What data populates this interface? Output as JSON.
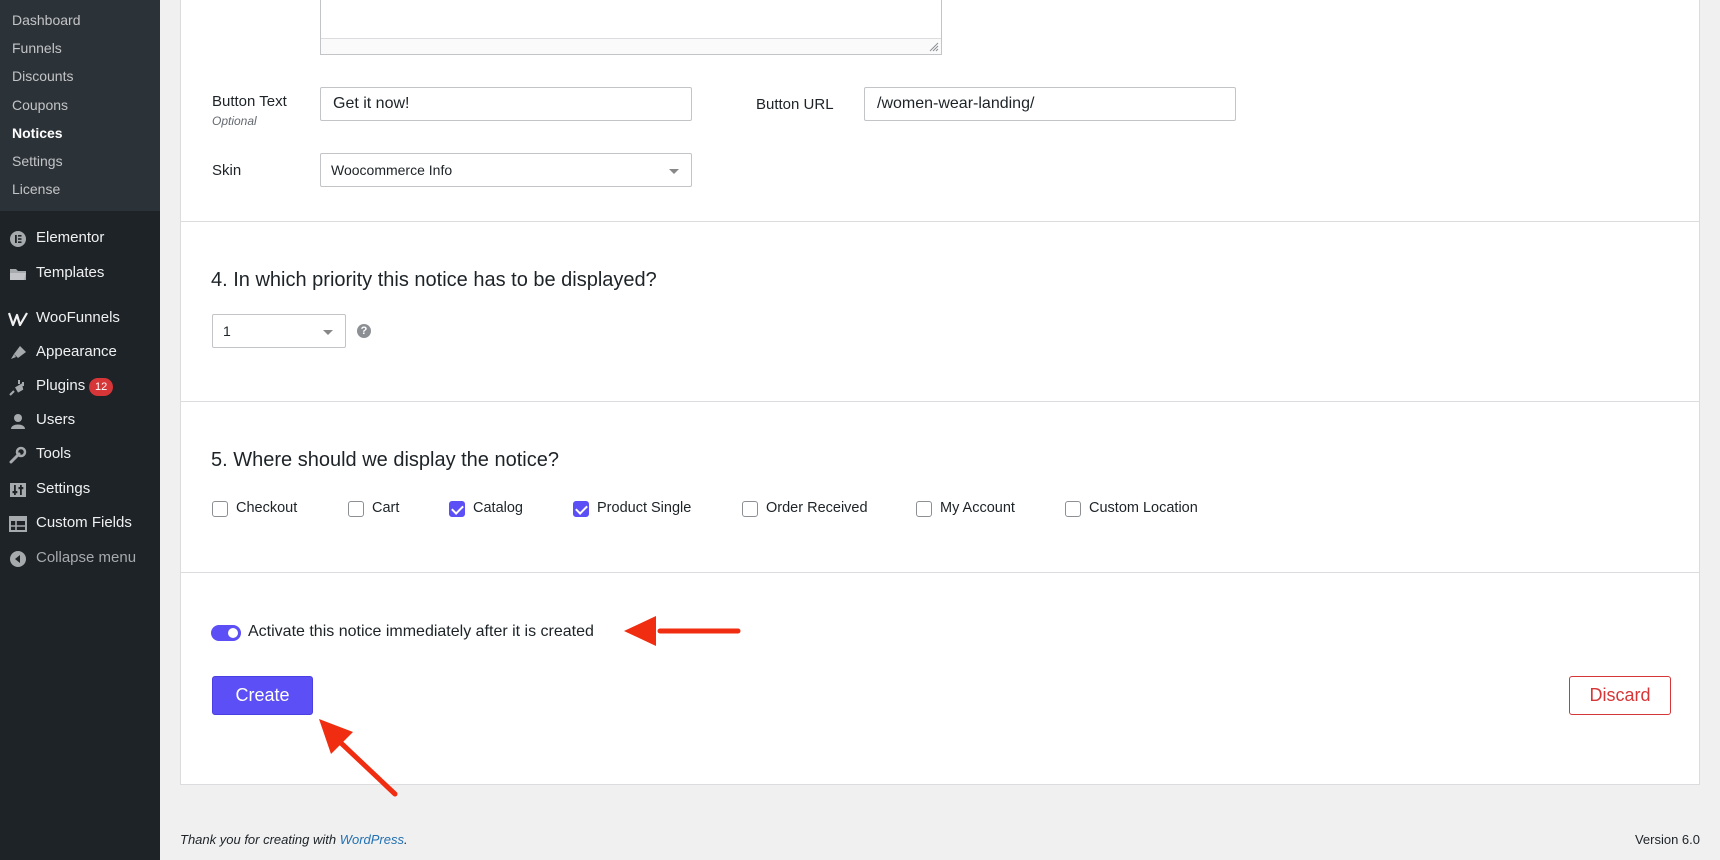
{
  "sidebar": {
    "submenu": [
      {
        "label": "Dashboard"
      },
      {
        "label": "Funnels"
      },
      {
        "label": "Discounts"
      },
      {
        "label": "Coupons"
      },
      {
        "label": "Notices",
        "current": true
      },
      {
        "label": "Settings"
      },
      {
        "label": "License"
      }
    ],
    "menu": [
      {
        "label": "Elementor",
        "icon": "elementor-icon"
      },
      {
        "label": "Templates",
        "icon": "folder-icon"
      },
      {
        "label": "WooFunnels",
        "icon": "woofunnels-icon"
      },
      {
        "label": "Appearance",
        "icon": "paintbrush-icon"
      },
      {
        "label": "Plugins",
        "icon": "plugin-icon",
        "badge": "12"
      },
      {
        "label": "Users",
        "icon": "user-icon"
      },
      {
        "label": "Tools",
        "icon": "wrench-icon"
      },
      {
        "label": "Settings",
        "icon": "settings-sliders-icon"
      },
      {
        "label": "Custom Fields",
        "icon": "table-icon"
      },
      {
        "label": "Collapse menu",
        "icon": "collapse-icon"
      }
    ]
  },
  "form": {
    "button_text": {
      "label": "Button Text",
      "sublabel": "Optional",
      "value": "Get it now!"
    },
    "button_url": {
      "label": "Button URL",
      "value": "/women-wear-landing/"
    },
    "skin": {
      "label": "Skin",
      "value": "Woocommerce Info"
    }
  },
  "priority": {
    "title": "4. In which priority this notice has to be displayed?",
    "value": "1",
    "help": "?"
  },
  "display": {
    "title": "5. Where should we display the notice?",
    "options": [
      {
        "label": "Checkout",
        "checked": false
      },
      {
        "label": "Cart",
        "checked": false
      },
      {
        "label": "Catalog",
        "checked": true
      },
      {
        "label": "Product Single",
        "checked": true
      },
      {
        "label": "Order Received",
        "checked": false
      },
      {
        "label": "My Account",
        "checked": false
      },
      {
        "label": "Custom Location",
        "checked": false
      }
    ]
  },
  "activate": {
    "label": "Activate this notice immediately after it is created",
    "on": true
  },
  "actions": {
    "create": "Create",
    "discard": "Discard"
  },
  "footer": {
    "thanks_pre": "Thank you for creating with ",
    "link": "WordPress",
    "thanks_post": ".",
    "version": "Version 6.0"
  },
  "colors": {
    "accent": "#5b4ff5",
    "danger": "#d63638",
    "annotation": "#f02d10",
    "sidebar": "#1d2327"
  }
}
